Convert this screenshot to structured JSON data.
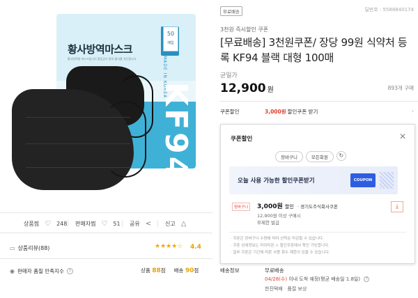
{
  "product_image": {
    "package_title": "황사방역마스크",
    "package_fine_print": "황사방역용 마스크입니다 흡입공기 중의 황사를 차단합니다",
    "badge_size": "대형",
    "badge_color": "블랙",
    "badge_count": "50",
    "badge_count_unit": "매입",
    "made_in": "MADE IN KOREA",
    "grade": "KF94"
  },
  "stats": {
    "favorite_label": "상품찜",
    "favorite_count": "248",
    "seller_fav_label": "판매자찜",
    "seller_fav_count": "51",
    "share_label": "공유",
    "report_label": "신고"
  },
  "review": {
    "label": "상품리뷰(88)",
    "stars": "★★★★☆",
    "score": "4.4"
  },
  "seller_quality": {
    "label": "판매자 품질 만족지수",
    "product_label": "상품",
    "product_score": "88",
    "delivery_label": "배송",
    "delivery_score": "90",
    "unit": "점"
  },
  "right": {
    "free_badge": "무료배송",
    "item_number": "딜번호 : 5588840174",
    "promo": "3천원 즉시할인 쿠폰",
    "title": "[무료배송] 3천원쿠폰/ 장당 99원 식약처 등록 KF94 블랙 대형 100매",
    "discount_label": "균일가",
    "price": "12,900",
    "price_unit": "원",
    "purchases": "893개 구매"
  },
  "coupon_row": {
    "label": "쿠폰할인",
    "amount": "3,000원",
    "text": "할인쿠폰 받기"
  },
  "popup": {
    "title": "쿠폰할인",
    "chips": [
      "장바구니",
      "모든회원"
    ],
    "banner_text": "오늘 사용 가능한 할인쿠폰받기",
    "banner_coupon": "COUPON",
    "card": {
      "tag": "장바구니",
      "amount": "3,000원",
      "discount": "할인",
      "issuer": "· 경기도주식회사쿠폰",
      "condition": "12,900원 이상 구매시",
      "expiry": "무제한 발급"
    },
    "notes": [
      "· 쿠폰은 장바구니 수량에 따라 선착순 마감될 수 있습니다.",
      "· 쿠폰 상세정보는 마이티몬 > 할인쿠폰에서 확인 가능합니다.",
      "· 일부 쿠폰은 기간에 따른 사용 횟수 제한이 있을 수 있습니다."
    ]
  },
  "shipping": {
    "label": "배송정보",
    "value": "무료배송",
    "eta_date": "04/28(수)",
    "eta_text": "이내 도착 예정(평균 배송일 1.8일)",
    "courier": "한진택배",
    "guarantee": "품절 보상"
  }
}
